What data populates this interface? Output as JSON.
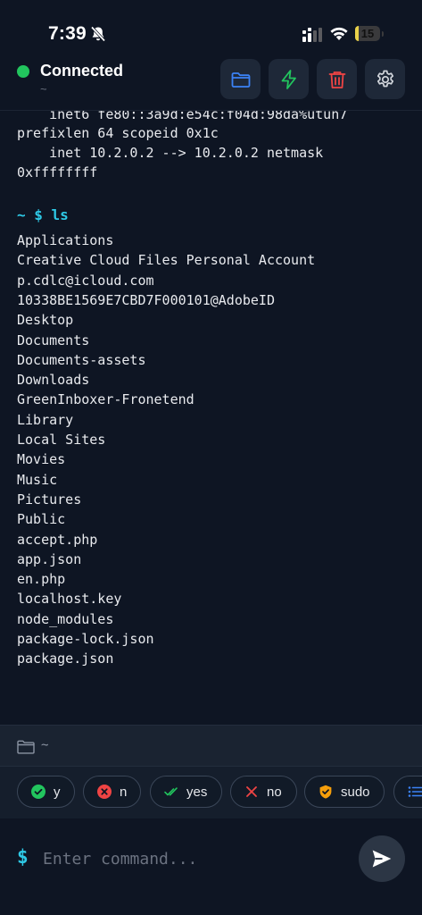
{
  "status_bar": {
    "time": "7:39",
    "battery": "15",
    "battery_level": 0.15
  },
  "header": {
    "connection_status": "Connected",
    "path": "~",
    "status_color": "#22c55e"
  },
  "terminal": {
    "lines": [
      "    inet6 fe80::3a9d:e54c:f04d:98da%utun7",
      "prefixlen 64 scopeid 0x1c",
      "    inet 10.2.0.2 --> 10.2.0.2 netmask",
      "0xffffffff"
    ],
    "prompt": "~ $ ls",
    "listing": [
      "Applications",
      "Creative Cloud Files Personal Account",
      "p.cdlc@icloud.com",
      "10338BE1569E7CBD7F000101@AdobeID",
      "Desktop",
      "Documents",
      "Documents-assets",
      "Downloads",
      "GreenInboxer-Fronetend",
      "Library",
      "Local Sites",
      "Movies",
      "Music",
      "Pictures",
      "Public",
      "accept.php",
      "app.json",
      "en.php",
      "localhost.key",
      "node_modules",
      "package-lock.json",
      "package.json"
    ]
  },
  "cwd_bar": {
    "path": "~"
  },
  "quick_replies": [
    {
      "label": "y",
      "icon": "check-circle-icon",
      "color": "#22c55e"
    },
    {
      "label": "n",
      "icon": "x-circle-icon",
      "color": "#ef4444"
    },
    {
      "label": "yes",
      "icon": "double-check-icon",
      "color": "#22c55e"
    },
    {
      "label": "no",
      "icon": "x-icon",
      "color": "#ef4444"
    },
    {
      "label": "sudo",
      "icon": "shield-check-icon",
      "color": "#f59e0b"
    },
    {
      "label": "",
      "icon": "list-icon",
      "color": "#3b82f6"
    }
  ],
  "input": {
    "prompt_symbol": "$",
    "placeholder": "Enter command...",
    "value": ""
  },
  "colors": {
    "accent": "#2ec9e6",
    "folder": "#3b82f6",
    "lightning": "#22c55e",
    "trash": "#ef4444",
    "background": "#0e1523"
  }
}
